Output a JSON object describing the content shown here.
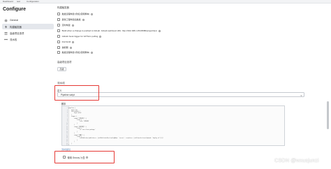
{
  "topbar": {
    "tabs": [
      "Dashboard",
      "test",
      "Configuration"
    ]
  },
  "sidebar": {
    "title": "Configure",
    "items": [
      {
        "label": "General",
        "icon": "gear-icon",
        "active": false
      },
      {
        "label": "构建触发器",
        "icon": "bolt-icon",
        "active": true
      },
      {
        "label": "高级项目选项",
        "icon": "settings-icon",
        "active": false
      },
      {
        "label": "流水线",
        "icon": "pipeline-icon",
        "active": false
      }
    ]
  },
  "triggers": {
    "header": "构建触发器",
    "options": [
      {
        "label": "触发远程构建 (例如,使用脚本)",
        "checked": false,
        "help": true
      },
      {
        "label": "其他工程构建后触发",
        "checked": false,
        "help": true
      },
      {
        "label": "定时构建",
        "checked": false,
        "help": true
      },
      {
        "label": "Build when a change is pushed to GitLab. GitLab webhook URL: http://192.168.1.254:8080/project/test",
        "checked": false,
        "help": true
      },
      {
        "label": "GitHub hook trigger for GITScm polling",
        "checked": false,
        "help": true
      },
      {
        "label": "Poll SCM",
        "checked": false,
        "help": true
      },
      {
        "label": "静默期",
        "checked": false,
        "help": true
      },
      {
        "label": "触发远程构建 (例如,使用脚本)",
        "checked": false,
        "help": true
      }
    ]
  },
  "advanced": {
    "header": "高级项目选项",
    "button": "高级"
  },
  "pipeline": {
    "header": "流水线",
    "definition_label": "定义",
    "definition_value": "Pipeline script",
    "script_label": "脚本",
    "code_lines": [
      "pipeline {",
      "    agent any",
      "    environment {",
      "        key='value'",
      "    }",
      "    stages {",
      "        stage('拉取代码') {",
      "            steps {",
      "                echo '拉取代码'",
      "            }",
      "        }",
      "        stage('编译构建') {",
      "            steps {",
      "                sh 'mvn clean package'",
      "            }",
      "        }",
      "        stage('部署') {",
      "            steps {",
      "                sshPublisher(publishers: [sshPublisherDesc(configName: 'server', transfers: [sshTransfer(execCommand: 'deploy.sh')])])",
      "            }",
      "        }",
      "    }",
      "}"
    ],
    "syntax_link": "流水线语法",
    "groovy_label": "使用 Groovy 沙盒",
    "groovy_checked": true
  },
  "watermark": "CSDN @wxusjunzi"
}
